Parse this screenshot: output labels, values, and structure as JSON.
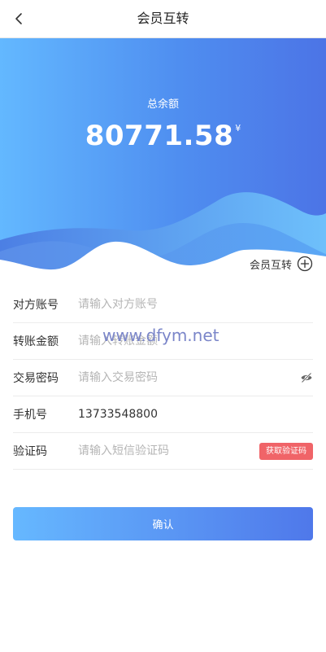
{
  "header": {
    "title": "会员互转"
  },
  "balance": {
    "label": "总余额",
    "amount": "80771.58",
    "currency": "¥"
  },
  "transfer_link": {
    "label": "会员互转"
  },
  "form": {
    "account": {
      "label": "对方账号",
      "placeholder": "请输入对方账号",
      "value": ""
    },
    "amount": {
      "label": "转账金额",
      "placeholder": "请输入转账金额",
      "value": ""
    },
    "password": {
      "label": "交易密码",
      "placeholder": "请输入交易密码",
      "value": ""
    },
    "phone": {
      "label": "手机号",
      "value": "13733548800"
    },
    "code": {
      "label": "验证码",
      "placeholder": "请输入短信验证码",
      "value": "",
      "button_label": "获取验证码"
    }
  },
  "watermark": "www.dfym.net",
  "confirm_label": "确认",
  "colors": {
    "hero_gradient_start": "#63b8ff",
    "hero_gradient_end": "#4c74e6",
    "code_button": "#f06468",
    "confirm_gradient_start": "#66b8ff",
    "confirm_gradient_end": "#4f78ea"
  },
  "icons": {
    "back": "chevron-left-icon",
    "add": "plus-circle-icon",
    "visibility": "eye-hidden-icon"
  }
}
